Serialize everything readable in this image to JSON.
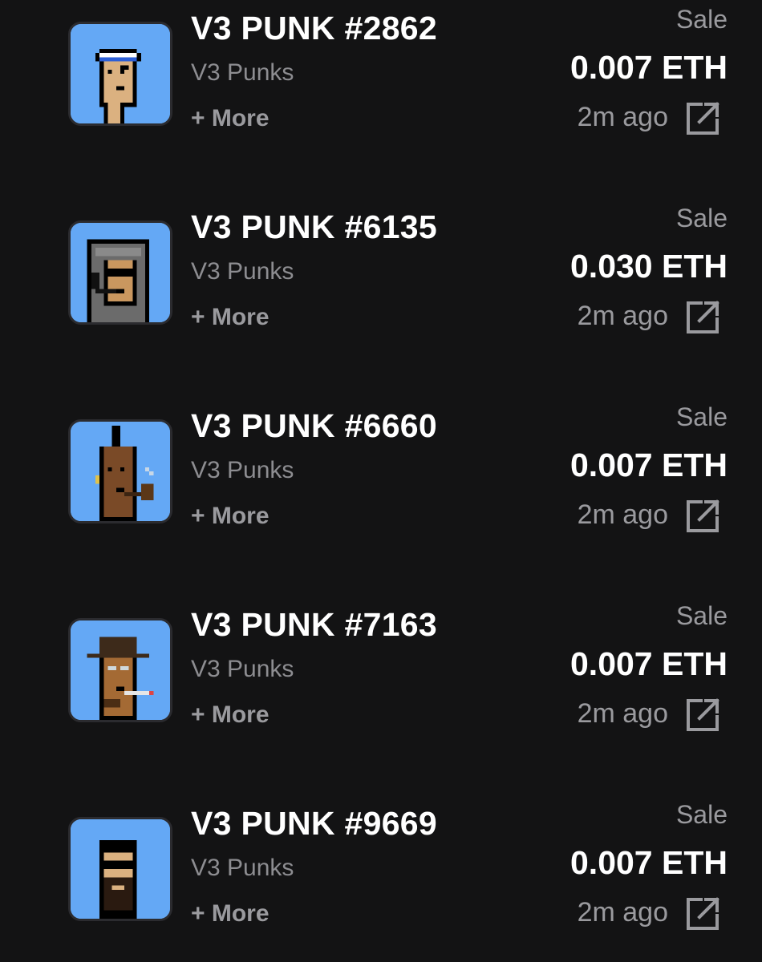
{
  "activity": [
    {
      "title": "V3 PUNK #2862",
      "collection": "V3 Punks",
      "more_label": "+ More",
      "event": "Sale",
      "price": "0.007 ETH",
      "time": "2m ago",
      "avatar_icon": "punk-headband-avatar"
    },
    {
      "title": "V3 PUNK #6135",
      "collection": "V3 Punks",
      "more_label": "+ More",
      "event": "Sale",
      "price": "0.030 ETH",
      "time": "2m ago",
      "avatar_icon": "punk-hoodie-avatar"
    },
    {
      "title": "V3 PUNK #6660",
      "collection": "V3 Punks",
      "more_label": "+ More",
      "event": "Sale",
      "price": "0.007 ETH",
      "time": "2m ago",
      "avatar_icon": "punk-mohawk-pipe-avatar"
    },
    {
      "title": "V3 PUNK #7163",
      "collection": "V3 Punks",
      "more_label": "+ More",
      "event": "Sale",
      "price": "0.007 ETH",
      "time": "2m ago",
      "avatar_icon": "punk-fedora-cigarette-avatar"
    },
    {
      "title": "V3 PUNK #9669",
      "collection": "V3 Punks",
      "more_label": "+ More",
      "event": "Sale",
      "price": "0.007 ETH",
      "time": "2m ago",
      "avatar_icon": "punk-beard-shades-avatar"
    }
  ],
  "colors": {
    "background": "#131314",
    "avatar_bg": "#64a8f5",
    "primary_text": "#ffffff",
    "secondary_text": "#8d8d91"
  },
  "icons": {
    "external_link": "external-link-icon"
  }
}
